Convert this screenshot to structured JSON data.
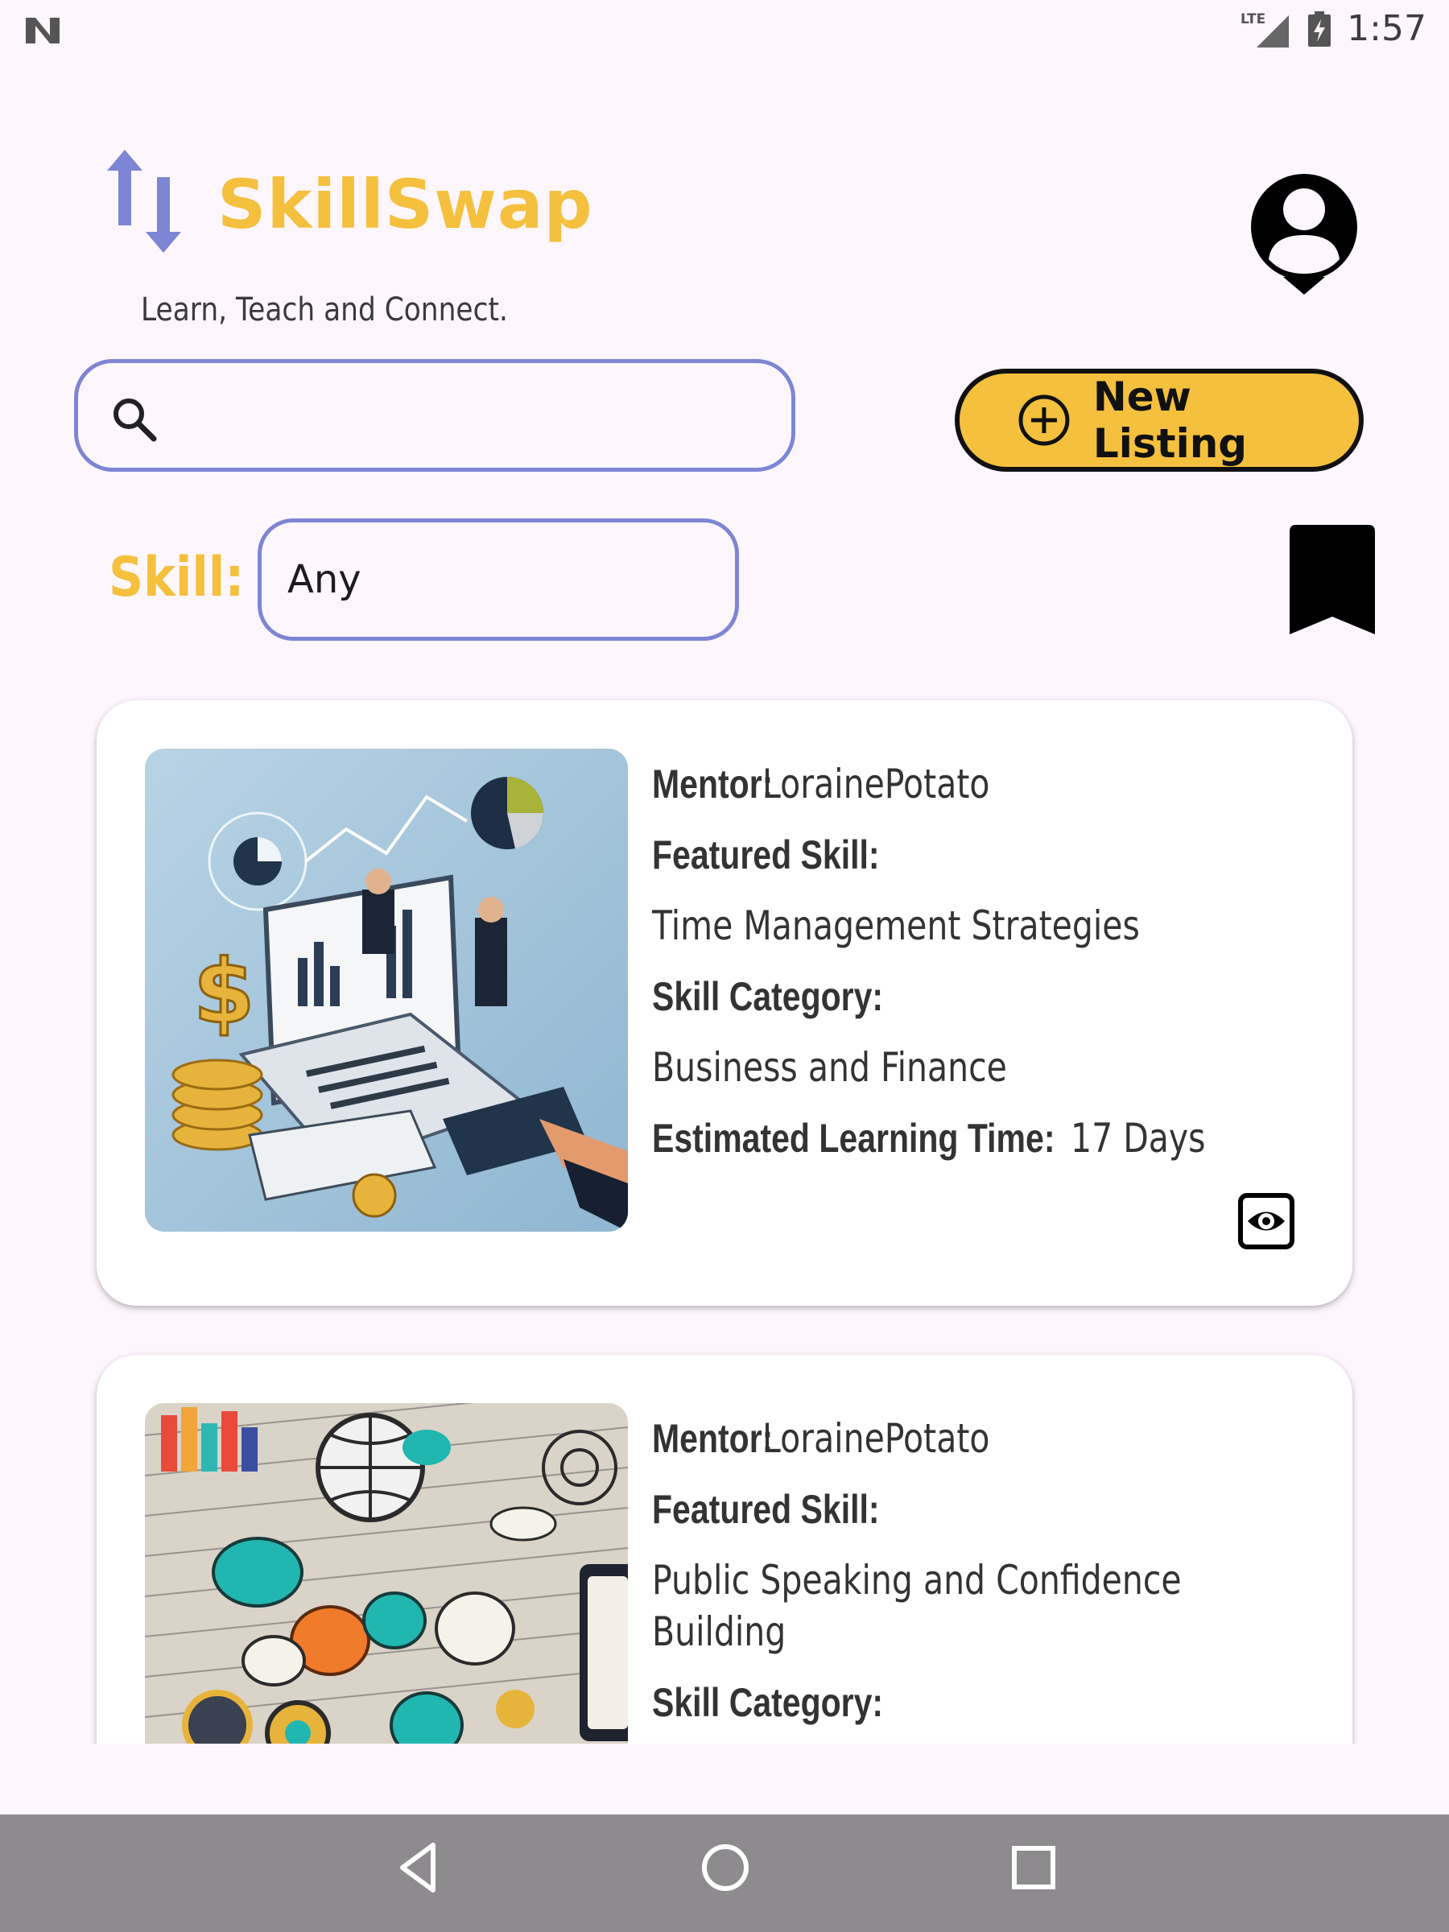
{
  "status_bar": {
    "network": "LTE",
    "time": "1:57"
  },
  "header": {
    "app_name": "SkillSwap",
    "tagline": "Learn, Teach and Connect."
  },
  "search": {
    "value": "",
    "placeholder": ""
  },
  "new_listing": {
    "label": "New Listing"
  },
  "filter": {
    "skill_label": "Skill:",
    "skill_value": "Any"
  },
  "listings": [
    {
      "mentor_label": "Mentor:",
      "mentor": "LorainePotato",
      "featured_label": "Featured Skill:",
      "featured_skill": "Time Management Strategies",
      "category_label": "Skill Category:",
      "category": "Business and Finance",
      "time_label": "Estimated Learning Time:",
      "time": "17 Days"
    },
    {
      "mentor_label": "Mentor:",
      "mentor": "LorainePotato",
      "featured_label": "Featured Skill:",
      "featured_skill": "Public Speaking and Confidence Building",
      "category_label": "Skill Category:"
    }
  ],
  "colors": {
    "accent_yellow": "#f4c03d",
    "outline_purple": "#7d86d4",
    "background": "#fdf6fd",
    "nav_bar": "#8e8b8f"
  },
  "icons": {
    "logo": "swap-arrows-icon",
    "profile": "account-circle-icon",
    "search": "search-icon",
    "add": "add-circle-icon",
    "bookmark": "bookmark-icon",
    "view": "eye-icon"
  }
}
